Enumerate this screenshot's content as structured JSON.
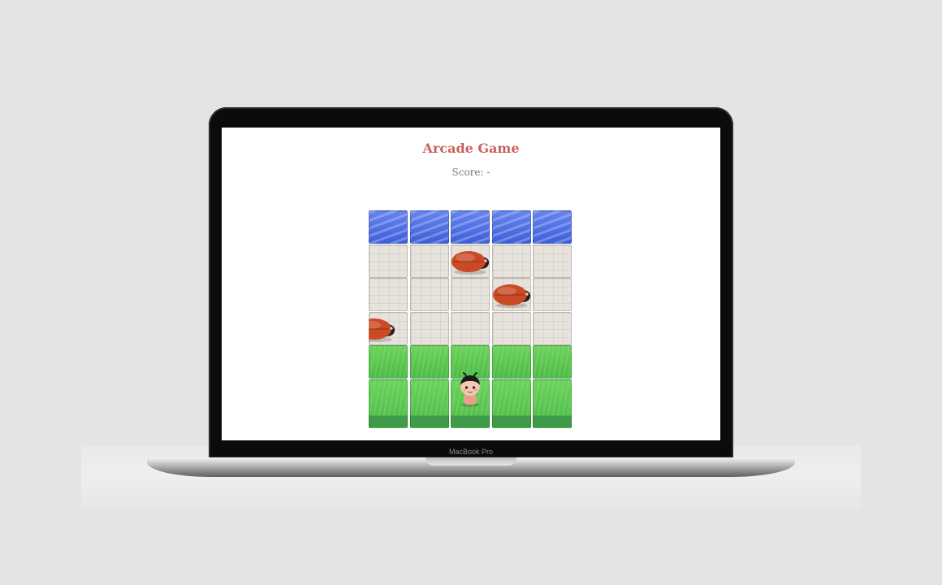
{
  "device": {
    "label": "MacBook Pro"
  },
  "page": {
    "title": "Arcade Game",
    "score_label": "Score:",
    "score_value": "-"
  },
  "game": {
    "rows": [
      "water",
      "stone",
      "stone",
      "stone",
      "grass",
      "grass"
    ],
    "columns": 5,
    "enemies": [
      {
        "row": 1,
        "col": 2,
        "icon": "ladybug-enemy-icon"
      },
      {
        "row": 2,
        "col": 3,
        "icon": "ladybug-enemy-icon"
      },
      {
        "row": 3,
        "col": -0.3,
        "icon": "ladybug-enemy-icon"
      }
    ],
    "player": {
      "row": 5,
      "col": 2,
      "icon": "boy-character-icon"
    }
  },
  "colors": {
    "title": "#c9605a",
    "score": "#777777",
    "water": "#3d5fd9",
    "stone": "#e7e3dc",
    "grass": "#4dbb45",
    "enemy": "#c94a25"
  }
}
